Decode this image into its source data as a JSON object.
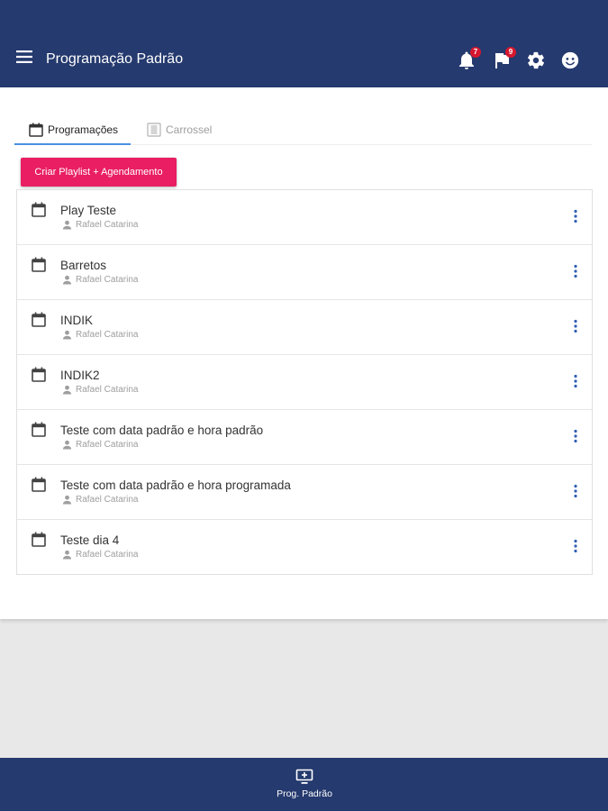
{
  "header": {
    "title": "Programação Padrão",
    "notifications_count": "7",
    "flags_count": "9",
    "icons": [
      "menu-icon",
      "bell-icon",
      "flag-icon",
      "gear-icon",
      "user-face-icon"
    ]
  },
  "tabs": [
    {
      "label": "Programações",
      "icon": "calendar-icon",
      "active": true
    },
    {
      "label": "Carrossel",
      "icon": "carousel-icon",
      "active": false
    }
  ],
  "create_button": "Criar Playlist + Agendamento",
  "items": [
    {
      "title": "Play Teste",
      "owner": "Rafael Catarina"
    },
    {
      "title": "Barretos",
      "owner": "Rafael Catarina"
    },
    {
      "title": "INDIK",
      "owner": "Rafael Catarina"
    },
    {
      "title": "INDIK2",
      "owner": "Rafael Catarina"
    },
    {
      "title": "Teste com data padrão e hora padrão",
      "owner": "Rafael Catarina"
    },
    {
      "title": "Teste com data padrão e hora programada",
      "owner": "Rafael Catarina"
    },
    {
      "title": "Teste dia 4",
      "owner": "Rafael Catarina"
    }
  ],
  "bottom_nav": {
    "label": "Prog. Padrão",
    "icon": "monitor-add-icon"
  },
  "colors": {
    "primary": "#253a6e",
    "accent": "#e91e63",
    "badge": "#d6172f",
    "tab_indicator": "#4a90e2"
  }
}
